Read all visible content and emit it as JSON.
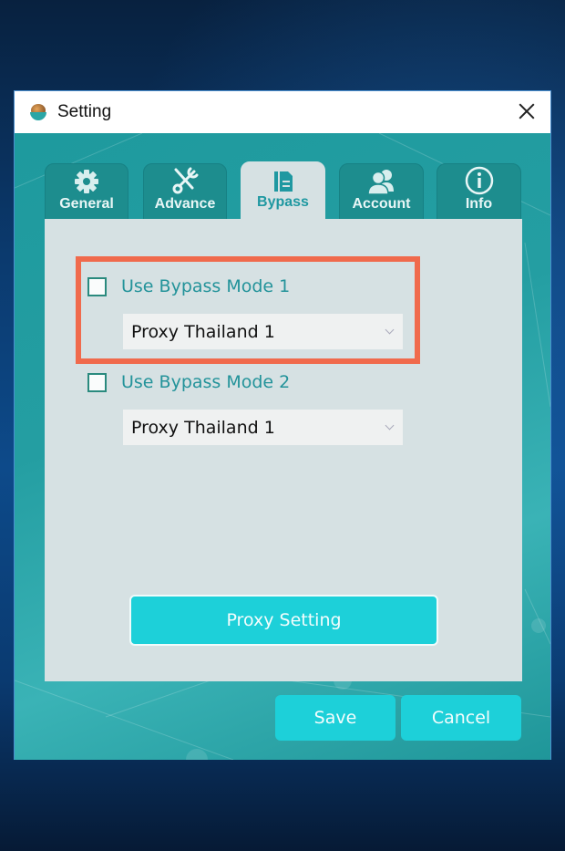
{
  "window": {
    "title": "Setting",
    "icon": "app-logo-icon"
  },
  "tabs": [
    {
      "label": "General",
      "icon": "gear-icon",
      "active": false
    },
    {
      "label": "Advance",
      "icon": "tools-icon",
      "active": false
    },
    {
      "label": "Bypass",
      "icon": "document-icon",
      "active": true
    },
    {
      "label": "Account",
      "icon": "users-icon",
      "active": false
    },
    {
      "label": "Info",
      "icon": "info-icon",
      "active": false
    }
  ],
  "bypass": {
    "mode1": {
      "label": "Use Bypass Mode 1",
      "checked": false,
      "selected": "Proxy Thailand 1"
    },
    "mode2": {
      "label": "Use Bypass Mode 2",
      "checked": false,
      "selected": "Proxy Thailand 1"
    },
    "proxy_setting_label": "Proxy Setting"
  },
  "footer": {
    "save_label": "Save",
    "cancel_label": "Cancel"
  },
  "colors": {
    "accent": "#1dd0d9",
    "highlight": "#f06a4c",
    "body_teal": "#249ea2",
    "label_teal": "#23939a"
  }
}
